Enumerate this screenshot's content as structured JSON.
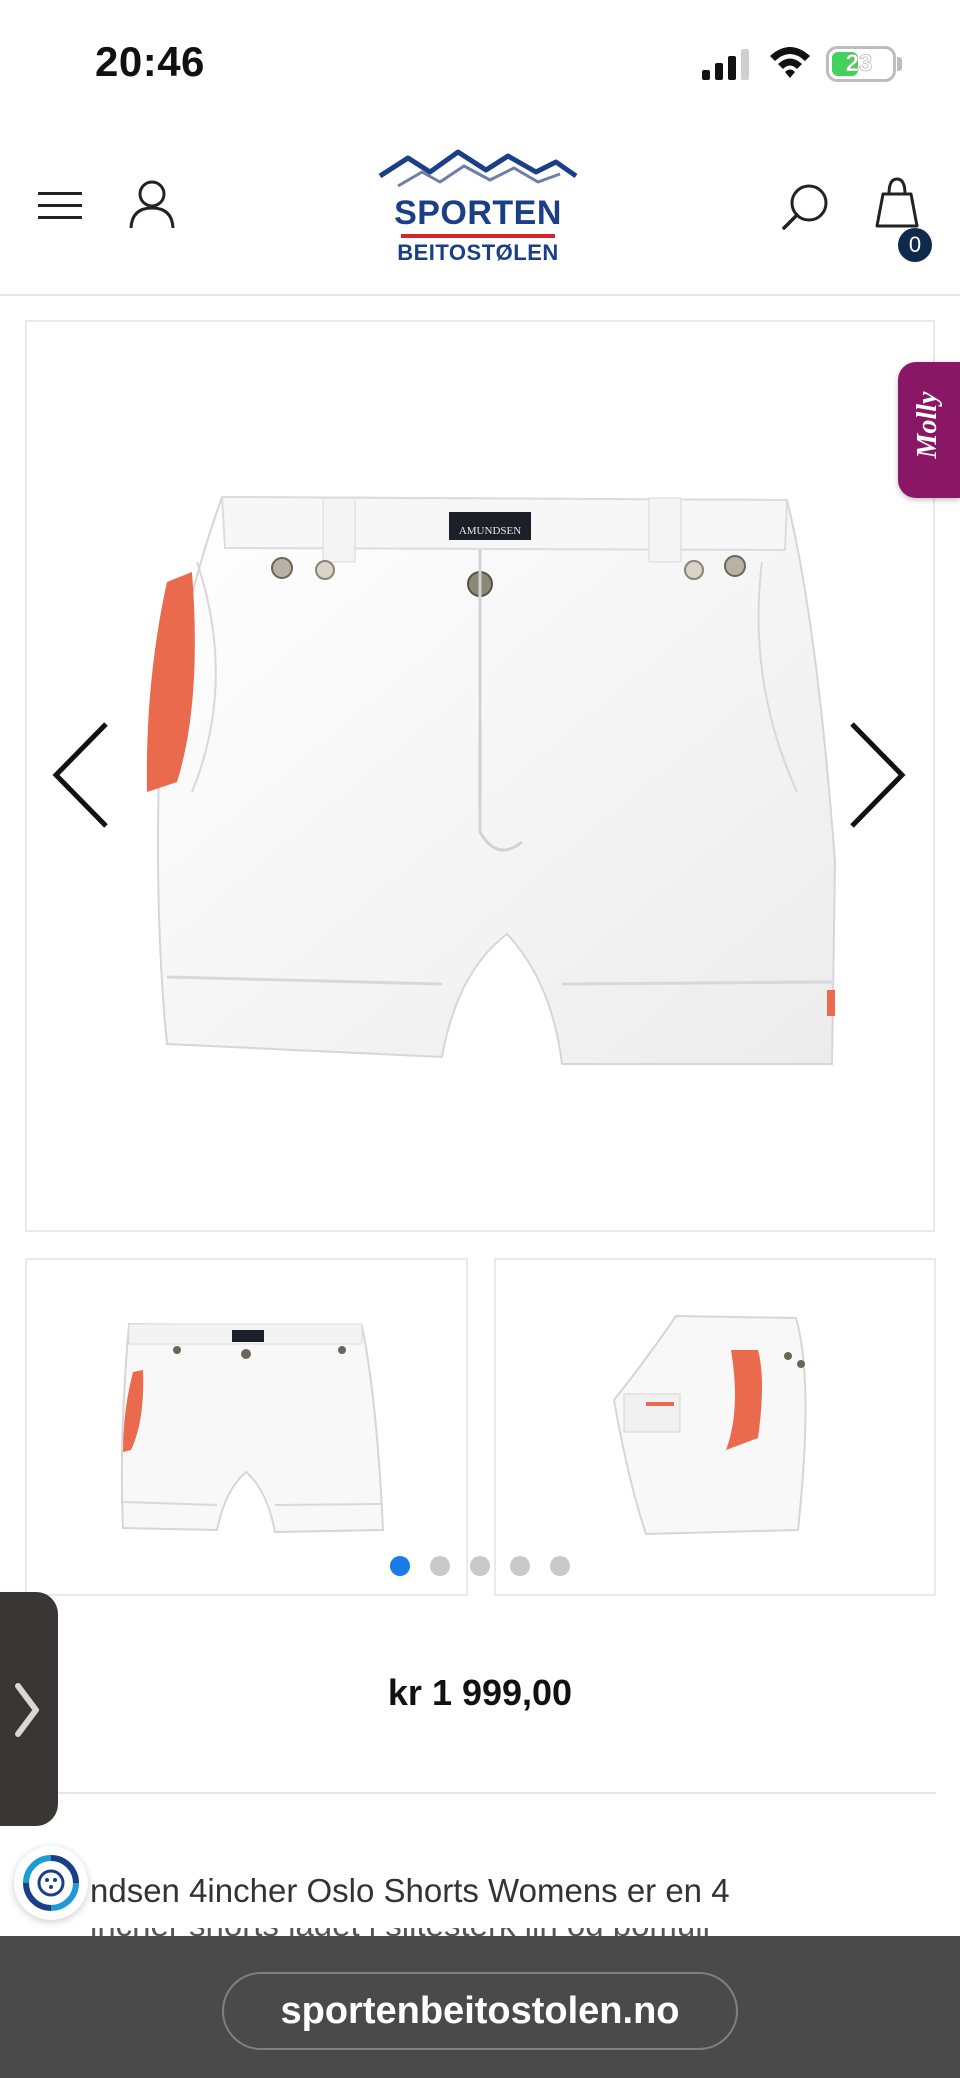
{
  "status_bar": {
    "time": "20:46",
    "battery_level": "23"
  },
  "header": {
    "logo_line_1": "SPORTEN",
    "logo_line_2": "BEITOSTØLEN",
    "cart_count": "0"
  },
  "product_image": {
    "brand_label": "AMUNDSEN"
  },
  "side_widget": {
    "label": "Molly"
  },
  "gallery": {
    "dot_count": 5,
    "active_dot": 1
  },
  "product": {
    "price": "kr 1 999,00",
    "description_line_1": "ndsen 4incher Oslo Shorts Womens er en 4",
    "description_line_2": "incher shorts laget i slitesterk lin og bomull"
  },
  "browser": {
    "url": "sportenbeitostolen.no"
  },
  "colors": {
    "accent_blue": "#1b3f86",
    "logo_red": "#d8242c",
    "molly_purple": "#8a1766",
    "active_dot": "#1a7ae8"
  }
}
